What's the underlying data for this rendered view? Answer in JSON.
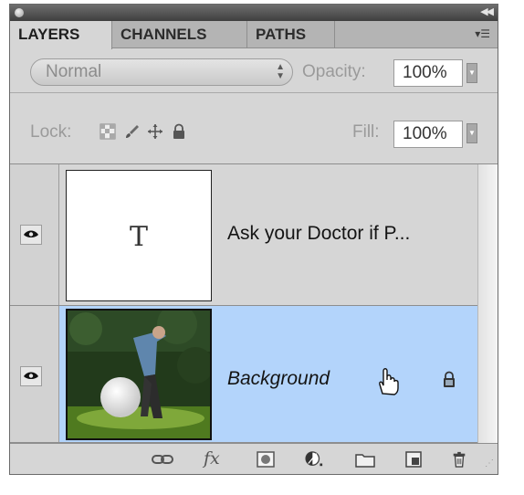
{
  "tabs": [
    {
      "label": "LAYERS",
      "active": true
    },
    {
      "label": "CHANNELS",
      "active": false
    },
    {
      "label": "PATHS",
      "active": false
    }
  ],
  "blend_mode": {
    "value": "Normal"
  },
  "opacity": {
    "label": "Opacity:",
    "value": "100%"
  },
  "lock": {
    "label": "Lock:"
  },
  "fill": {
    "label": "Fill:",
    "value": "100%"
  },
  "layers": [
    {
      "name": "Ask your Doctor if P...",
      "thumbnail_glyph": "T",
      "visible": true,
      "selected": false,
      "italic": false,
      "locked": false
    },
    {
      "name": "Background",
      "visible": true,
      "selected": true,
      "italic": true,
      "locked": true
    }
  ],
  "bottom_icons": [
    "link-layers-icon",
    "fx-icon",
    "add-mask-icon",
    "adjustment-layer-icon",
    "new-group-icon",
    "new-layer-icon",
    "delete-layer-icon"
  ],
  "bottom_fx_text": "fx",
  "colors": {
    "selected_row": "#b3d4fb",
    "panel_bg": "#d6d6d6"
  }
}
